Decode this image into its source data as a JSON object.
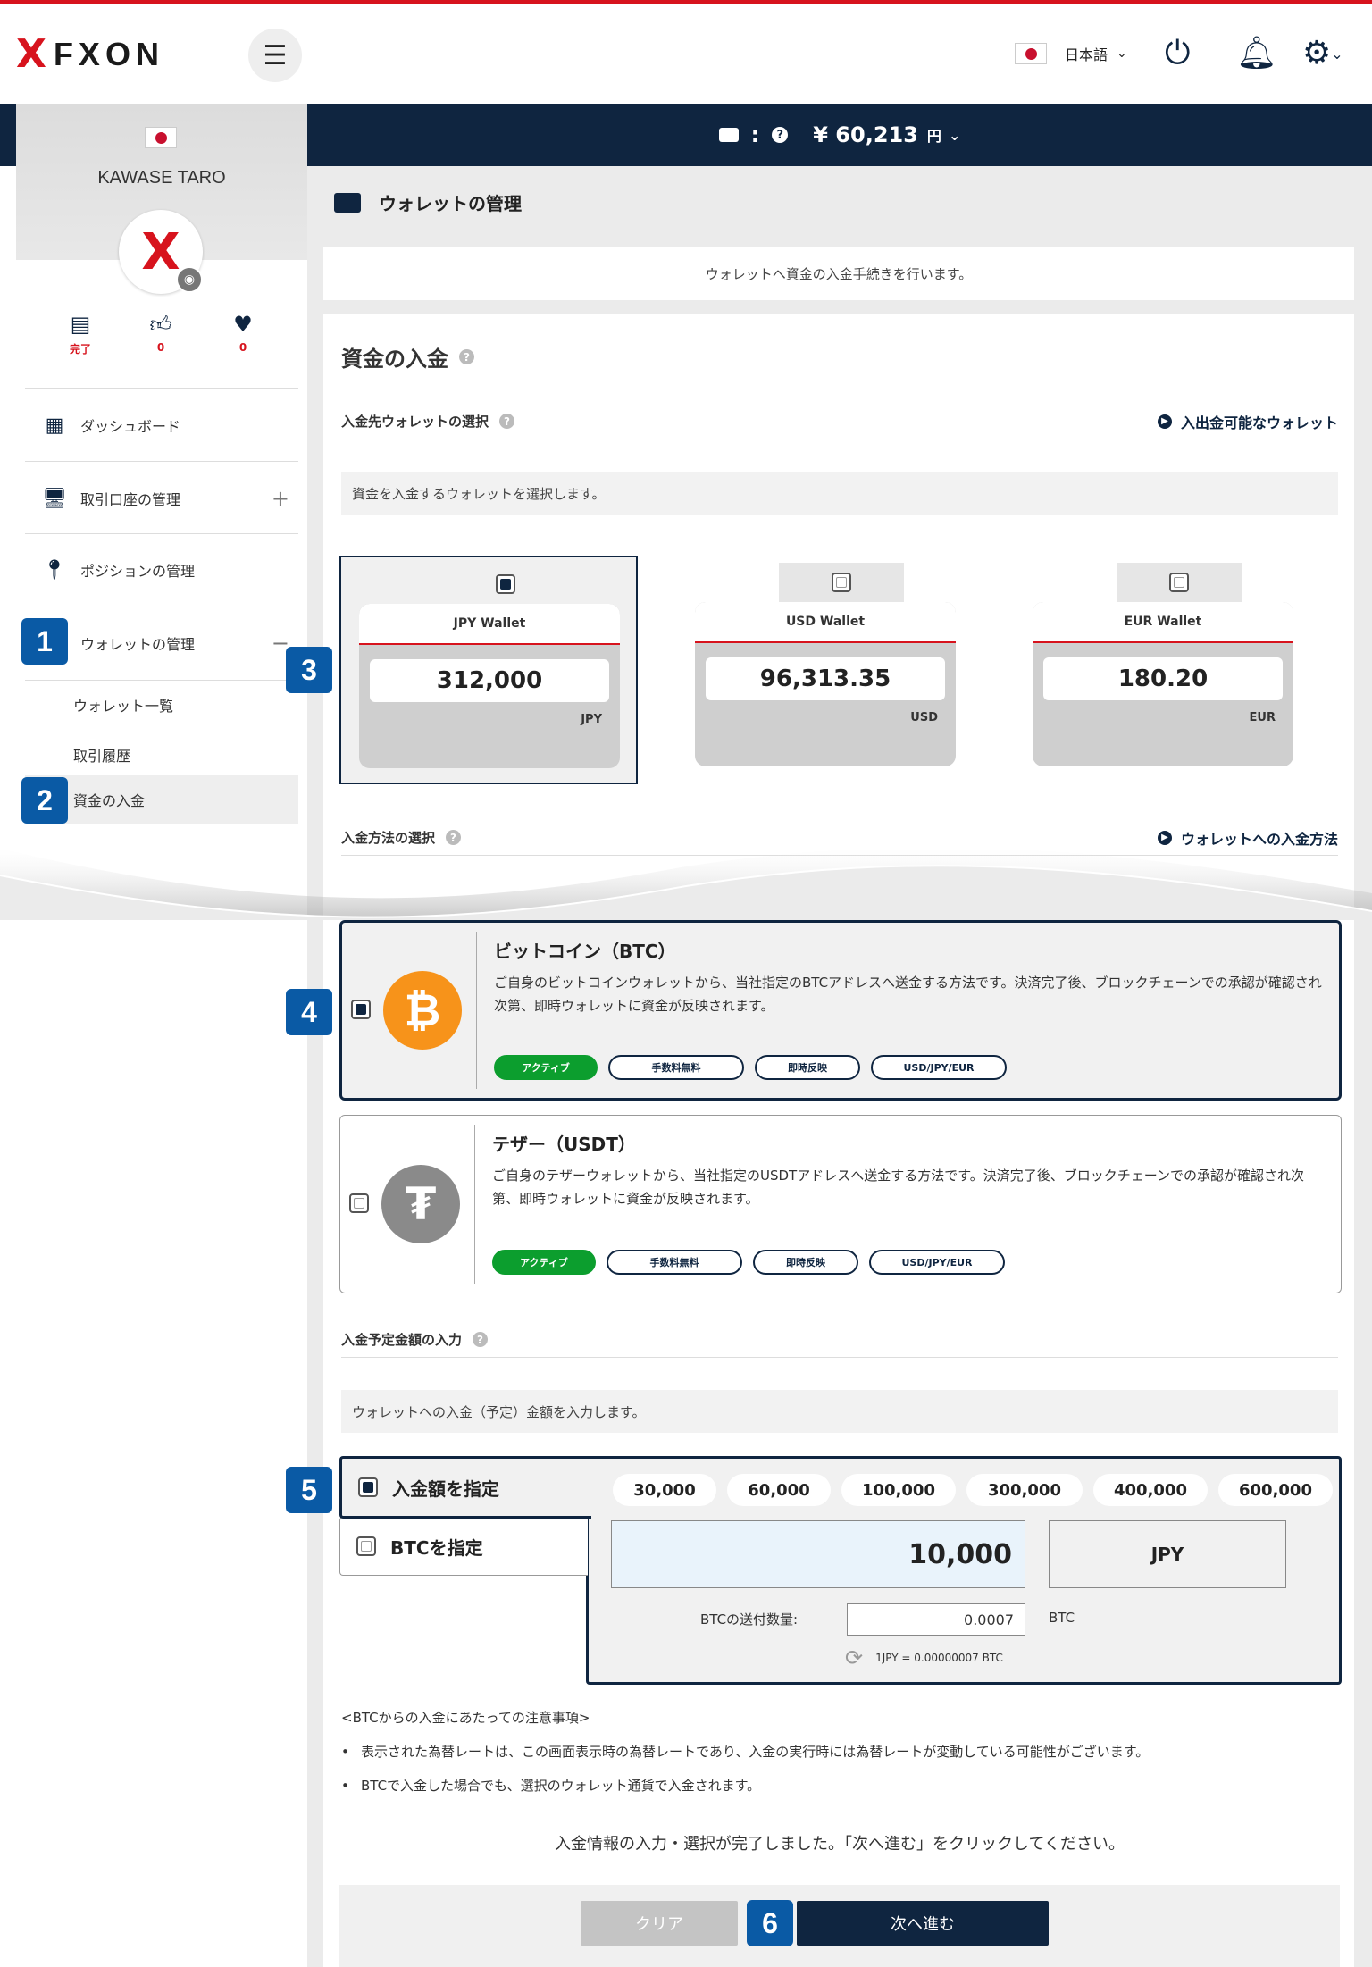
{
  "header": {
    "brand": "FXON",
    "brand_mark": "X",
    "menu_icon": "hamburger-icon",
    "language": "日本語",
    "power_icon": "power-icon",
    "bell_icon": "bell-icon",
    "settings_icon": "gear-icon"
  },
  "balance": {
    "amount": "¥ 60,213",
    "unit": "円"
  },
  "user": {
    "name": "KAWASE TARO",
    "avatar_mark": "X",
    "stats": [
      {
        "icon": "id-card-check-icon",
        "value": "完了"
      },
      {
        "icon": "thumbs-up-icon",
        "value": "0"
      },
      {
        "icon": "heart-icon",
        "value": "0"
      }
    ]
  },
  "sidebar": {
    "items": [
      {
        "icon": "grid-icon",
        "label": "ダッシュボード"
      },
      {
        "icon": "monitor-icon",
        "label": "取引口座の管理",
        "toggle": "+"
      },
      {
        "icon": "map-pin-icon",
        "label": "ポジションの管理"
      },
      {
        "icon": "wallet-icon",
        "label": "ウォレットの管理",
        "toggle": "−"
      }
    ],
    "subitems": [
      "ウォレット一覧",
      "取引履歴",
      "資金の入金"
    ]
  },
  "page": {
    "title": "ウォレットの管理",
    "intro": "ウォレットへ資金の入金手続きを行います。",
    "heading": "資金の入金"
  },
  "wallet_section": {
    "title": "入金先ウォレットの選択",
    "link": "入出金可能なウォレット",
    "desc": "資金を入金するウォレットを選択します。",
    "wallets": [
      {
        "name": "JPY Wallet",
        "amount": "312,000",
        "currency": "JPY",
        "selected": true
      },
      {
        "name": "USD Wallet",
        "amount": "96,313.35",
        "currency": "USD",
        "selected": false
      },
      {
        "name": "EUR Wallet",
        "amount": "180.20",
        "currency": "EUR",
        "selected": false
      }
    ]
  },
  "method_section": {
    "title": "入金方法の選択",
    "link": "ウォレットへの入金方法",
    "methods": [
      {
        "title": "ビットコイン（BTC）",
        "desc": "ご自身のビットコインウォレットから、当社指定のBTCアドレスへ送金する方法です。決済完了後、ブロックチェーンでの承認が確認され次第、即時ウォレットに資金が反映されます。",
        "coin": "₿",
        "coin_color": "#f7931a",
        "tags": [
          "アクティブ",
          "手数料無料",
          "即時反映",
          "USD/JPY/EUR"
        ]
      },
      {
        "title": "テザー（USDT）",
        "desc": "ご自身のテザーウォレットから、当社指定のUSDTアドレスへ送金する方法です。決済完了後、ブロックチェーンでの承認が確認され次第、即時ウォレットに資金が反映されます。",
        "coin": "₮",
        "coin_color": "#8a8a8a",
        "tags": [
          "アクティブ",
          "手数料無料",
          "即時反映",
          "USD/JPY/EUR"
        ]
      }
    ]
  },
  "amount_section": {
    "title": "入金予定金額の入力",
    "desc": "ウォレットへの入金（予定）金額を入力します。",
    "mode_amount": "入金額を指定",
    "mode_btc": "BTCを指定",
    "presets": [
      "30,000",
      "60,000",
      "100,000",
      "300,000",
      "400,000",
      "600,000"
    ],
    "amount_value": "10,000",
    "currency": "JPY",
    "btc_label": "BTCの送付数量:",
    "btc_value": "0.0007",
    "btc_unit": "BTC",
    "rate": "1JPY = 0.00000007 BTC"
  },
  "notes": {
    "title": "<BTCからの入金にあたっての注意事項>",
    "items": [
      "表示された為替レートは、この画面表示時の為替レートであり、入金の実行時には為替レートが変動している可能性がございます。",
      "BTCで入金した場合でも、選択のウォレット通貨で入金されます。"
    ]
  },
  "confirm_text": "入金情報の入力・選択が完了しました。「次へ進む」をクリックしてください。",
  "buttons": {
    "clear": "クリア",
    "next": "次へ進む"
  },
  "badges": [
    "1",
    "2",
    "3",
    "4",
    "5",
    "6"
  ],
  "colors": {
    "navy": "#0f2540",
    "accent_red": "#d7131d",
    "badge_blue": "#0a5aa5",
    "active_green": "#0c9e2e"
  }
}
